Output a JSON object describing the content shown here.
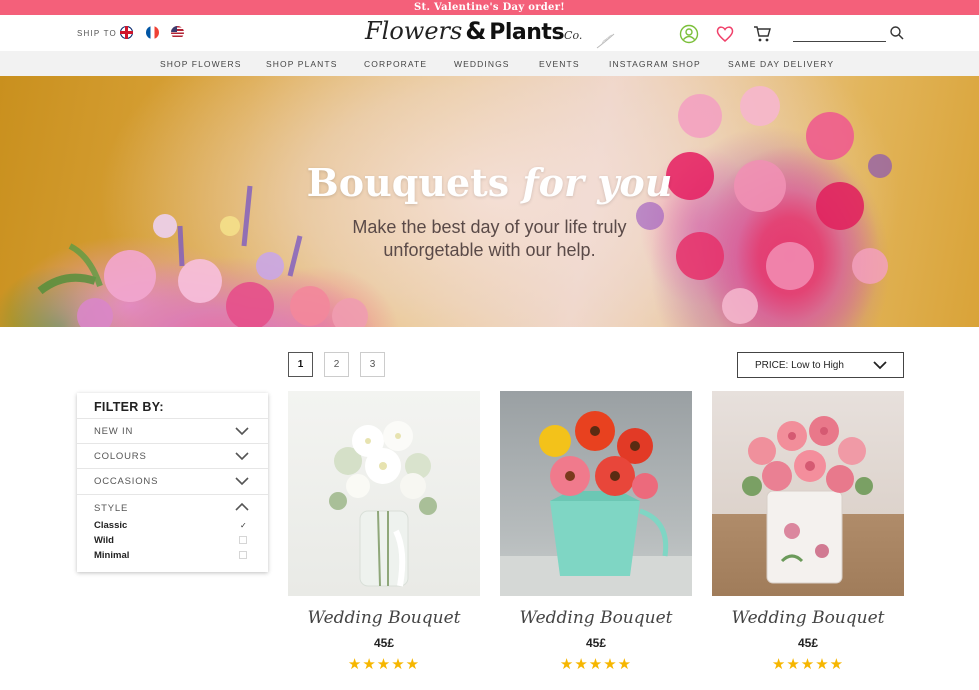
{
  "promo": {
    "text": "St. Valentine's Day order!"
  },
  "header": {
    "ship_to": "SHIP TO",
    "logo": {
      "part1": "Flowers",
      "amp": "&",
      "part2": "Plants",
      "suffix": "Co."
    },
    "search": {
      "placeholder": ""
    }
  },
  "nav": {
    "items": [
      {
        "label": "SHOP FLOWERS"
      },
      {
        "label": "SHOP PLANTS"
      },
      {
        "label": "CORPORATE"
      },
      {
        "label": "WEDDINGS"
      },
      {
        "label": "EVENTS"
      },
      {
        "label": "INSTAGRAM SHOP"
      },
      {
        "label": "SAME DAY DELIVERY"
      }
    ]
  },
  "hero": {
    "title_main": "Bouquets ",
    "title_accent": "for you",
    "subtitle_line1": "Make the best day of your life truly",
    "subtitle_line2": "unforgetable with our help."
  },
  "pagination": {
    "pages": [
      "1",
      "2",
      "3"
    ],
    "current": "1"
  },
  "sort": {
    "selected": "PRICE: Low to High"
  },
  "filter": {
    "title": "FILTER BY:",
    "sections": [
      {
        "label": "NEW IN"
      },
      {
        "label": "COLOURS"
      },
      {
        "label": "OCCASIONS"
      }
    ],
    "style": {
      "label": "STYLE",
      "options": [
        {
          "label": "Classic",
          "checked": true,
          "mark": "✓"
        },
        {
          "label": "Wild",
          "checked": false,
          "mark": ""
        },
        {
          "label": "Minimal",
          "checked": false,
          "mark": ""
        }
      ]
    }
  },
  "products": [
    {
      "name": "Wedding Bouquet",
      "price": "45£",
      "stars": "★★★★★",
      "rating": 5
    },
    {
      "name": "Wedding Bouquet",
      "price": "45£",
      "stars": "★★★★★",
      "rating": 5
    },
    {
      "name": "Wedding Bouquet",
      "price": "45£",
      "stars": "★★★★★",
      "rating": 5
    }
  ],
  "colors": {
    "promo": "#f4607a",
    "accent_green": "#7bbf3a",
    "accent_pink": "#f0406a",
    "star": "#f6b600"
  }
}
